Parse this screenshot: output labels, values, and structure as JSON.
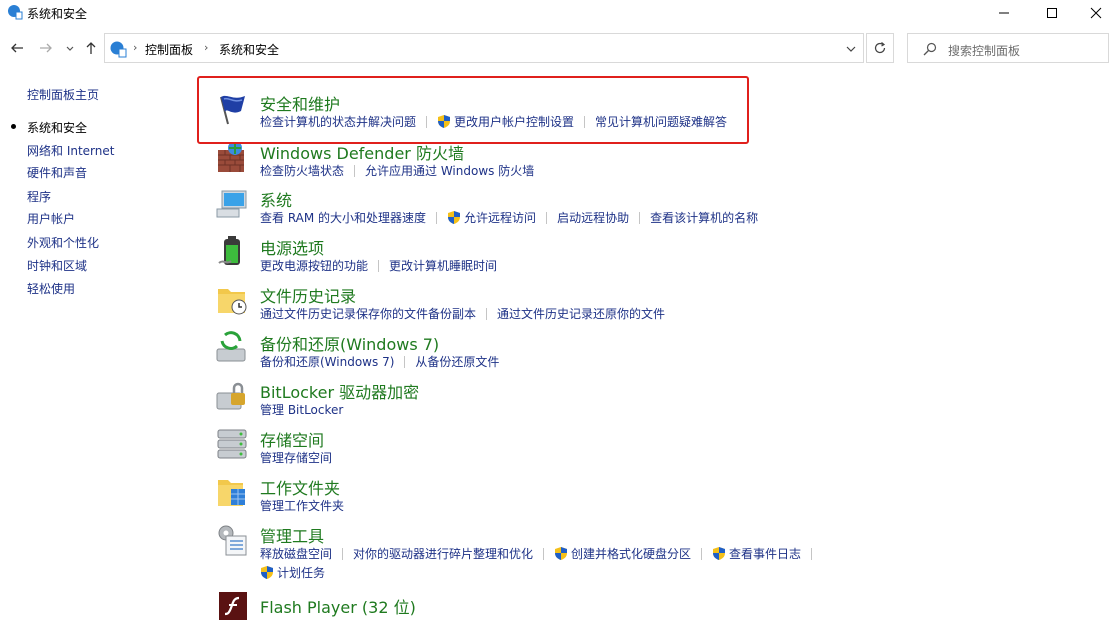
{
  "window": {
    "title": "系统和安全"
  },
  "address": {
    "crumbs": [
      "控制面板",
      "系统和安全"
    ],
    "search_placeholder": "搜索控制面板"
  },
  "leftnav": {
    "home": "控制面板主页",
    "items": [
      {
        "label": "系统和安全",
        "current": true
      },
      {
        "label": "网络和 Internet"
      },
      {
        "label": "硬件和声音"
      },
      {
        "label": "程序"
      },
      {
        "label": "用户帐户"
      },
      {
        "label": "外观和个性化"
      },
      {
        "label": "时钟和区域"
      },
      {
        "label": "轻松使用"
      }
    ]
  },
  "categories": [
    {
      "title": "安全和维护",
      "icon": "flag-icon",
      "links": [
        "检查计算机的状态并解决问题",
        "更改用户帐户控制设置",
        "常见计算机问题疑难解答"
      ]
    },
    {
      "title": "Windows Defender 防火墙",
      "icon": "firewall-icon",
      "links": [
        "检查防火墙状态",
        "允许应用通过 Windows 防火墙"
      ]
    },
    {
      "title": "系统",
      "icon": "computer-icon",
      "links": [
        "查看 RAM 的大小和处理器速度",
        "允许远程访问",
        "启动远程协助",
        "查看该计算机的名称"
      ]
    },
    {
      "title": "电源选项",
      "icon": "battery-icon",
      "links": [
        "更改电源按钮的功能",
        "更改计算机睡眠时间"
      ]
    },
    {
      "title": "文件历史记录",
      "icon": "file-history-icon",
      "links": [
        "通过文件历史记录保存你的文件备份副本",
        "通过文件历史记录还原你的文件"
      ]
    },
    {
      "title": "备份和还原(Windows 7)",
      "icon": "backup-icon",
      "links": [
        "备份和还原(Windows 7)",
        "从备份还原文件"
      ]
    },
    {
      "title": "BitLocker 驱动器加密",
      "icon": "bitlocker-icon",
      "links": [
        "管理 BitLocker"
      ]
    },
    {
      "title": "存储空间",
      "icon": "storage-icon",
      "links": [
        "管理存储空间"
      ]
    },
    {
      "title": "工作文件夹",
      "icon": "work-folders-icon",
      "links": [
        "管理工作文件夹"
      ]
    },
    {
      "title": "管理工具",
      "icon": "admin-tools-icon",
      "links": [
        "释放磁盘空间",
        "对你的驱动器进行碎片整理和优化",
        "创建并格式化硬盘分区",
        "查看事件日志",
        "计划任务"
      ]
    },
    {
      "title": "Flash Player (32 位)",
      "icon": "flash-icon",
      "links": []
    }
  ]
}
